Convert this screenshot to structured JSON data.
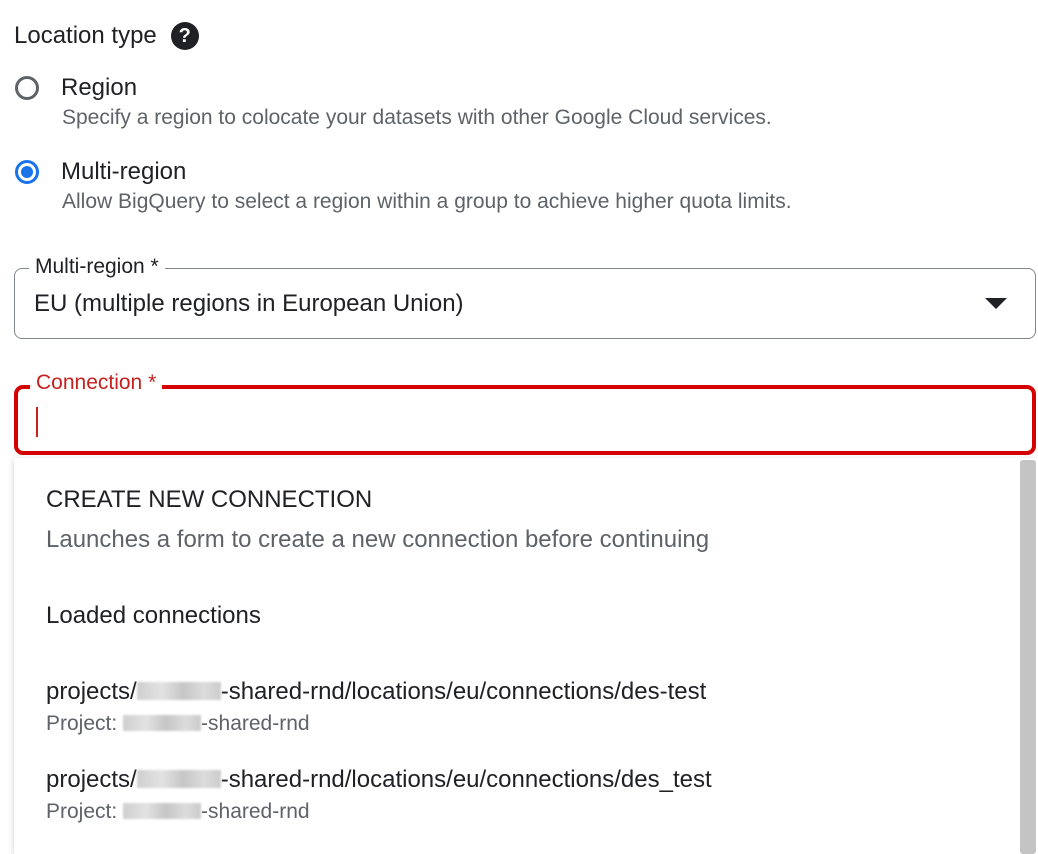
{
  "location_type": {
    "title": "Location type",
    "help_icon": "help-circle-icon",
    "options": [
      {
        "label": "Region",
        "description": "Specify a region to colocate your datasets with other Google Cloud services.",
        "selected": false
      },
      {
        "label": "Multi-region",
        "description": "Allow BigQuery to select a region within a group to achieve higher quota limits.",
        "selected": true
      }
    ]
  },
  "multi_region_select": {
    "label": "Multi-region *",
    "value": "EU (multiple regions in European Union)",
    "icon": "arrow-drop-down-icon"
  },
  "connection_input": {
    "label": "Connection *",
    "value": "",
    "state": "error-focused",
    "accent_color": "#d50000"
  },
  "dropdown": {
    "create": {
      "title": "CREATE NEW CONNECTION",
      "description": "Launches a form to create a new connection before continuing"
    },
    "group_title": "Loaded connections",
    "connections": [
      {
        "path_prefix": "projects/",
        "path_suffix": "-shared-rnd/locations/eu/connections/des-test",
        "project_prefix": "Project: ",
        "project_suffix": "-shared-rnd"
      },
      {
        "path_prefix": "projects/",
        "path_suffix": "-shared-rnd/locations/eu/connections/des_test",
        "project_prefix": "Project: ",
        "project_suffix": "-shared-rnd"
      }
    ]
  },
  "colors": {
    "primary": "#1a73e8",
    "error": "#d50000",
    "text": "#202124",
    "secondary_text": "#5f6368"
  }
}
